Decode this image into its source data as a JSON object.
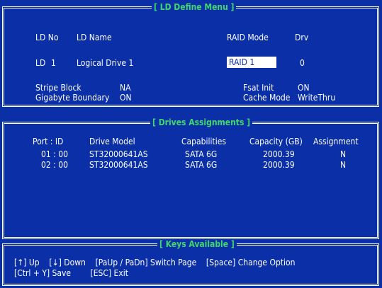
{
  "ld_define": {
    "title": "[ LD Define Menu ]",
    "headers": {
      "ld_no": "LD No",
      "ld_name": "LD Name",
      "raid_mode": "RAID Mode",
      "drv": "Drv"
    },
    "row": {
      "ld_label": "LD",
      "ld_num": "1",
      "name": "Logical Drive 1",
      "raid_mode": "RAID 1",
      "drv": "0"
    },
    "stripe_block_label": "Stripe Block",
    "stripe_block_value": "NA",
    "gigabyte_boundary_label": "Gigabyte Boundary",
    "gigabyte_boundary_value": "ON",
    "fast_init_label": "Fsat Init",
    "fast_init_value": "ON",
    "cache_mode_label": "Cache Mode",
    "cache_mode_value": "WriteThru"
  },
  "drives": {
    "title": "[ Drives Assignments ]",
    "columns": {
      "port": "Port : ID",
      "model": "Drive Model",
      "cap": "Capabilities",
      "size": "Capacity (GB)",
      "assign": "Assignment"
    },
    "rows": [
      {
        "port": "01 : 00",
        "model": "ST32000641AS",
        "cap": "SATA 6G",
        "size": "2000.39",
        "assign": "N"
      },
      {
        "port": "02 : 00",
        "model": "ST32000641AS",
        "cap": "SATA 6G",
        "size": "2000.39",
        "assign": "N"
      }
    ]
  },
  "keys": {
    "title": "[ Keys Available ]",
    "line1": "[↑] Up    [↓] Down    [PaUp / PaDn] Switch Page    [Space] Change Option",
    "line2": "[Ctrl + Y] Save        [ESC] Exit"
  },
  "colors": {
    "background": "#0a2fa6",
    "title": "#3fd86a",
    "text": "#ffffff"
  }
}
